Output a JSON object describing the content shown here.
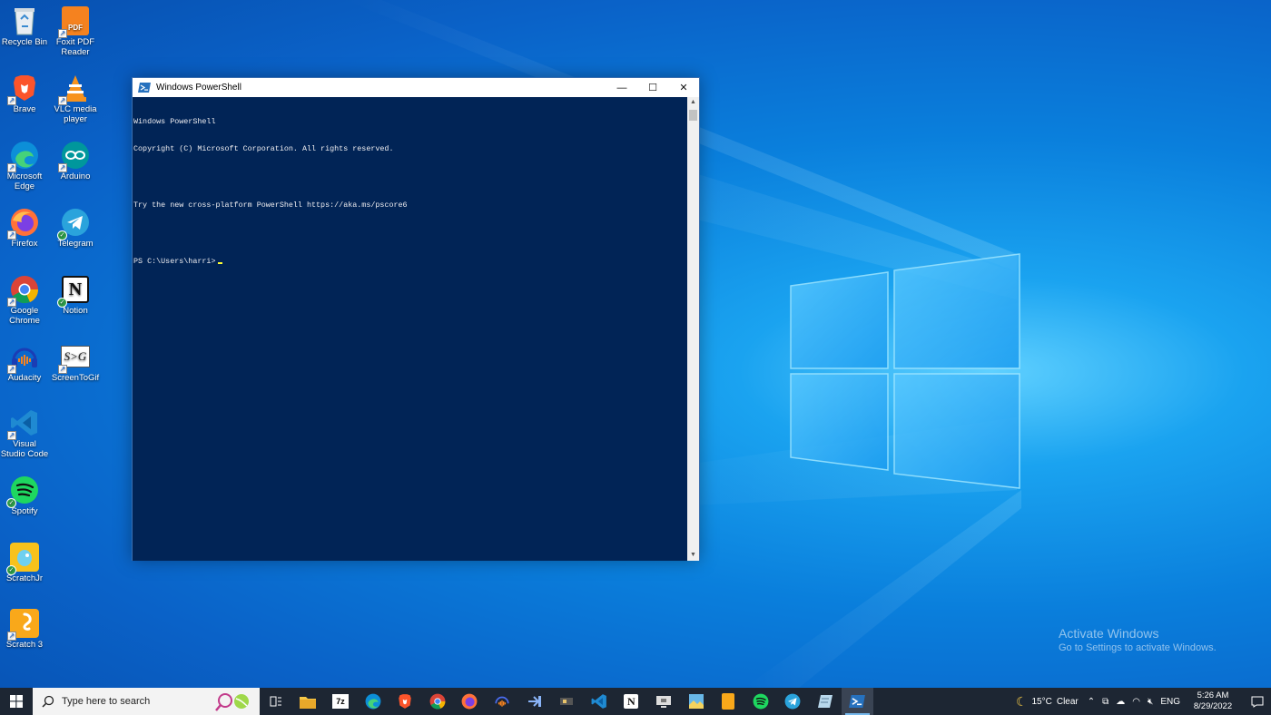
{
  "desktop_icons": [
    {
      "label": "Recycle Bin",
      "icon": "recycle-bin-icon"
    },
    {
      "label": "Foxit PDF Reader",
      "icon": "foxit-pdf-icon"
    },
    {
      "label": "Brave",
      "icon": "brave-icon"
    },
    {
      "label": "VLC media player",
      "icon": "vlc-icon"
    },
    {
      "label": "Microsoft Edge",
      "icon": "edge-icon"
    },
    {
      "label": "Arduino",
      "icon": "arduino-icon"
    },
    {
      "label": "Firefox",
      "icon": "firefox-icon"
    },
    {
      "label": "Telegram",
      "icon": "telegram-icon"
    },
    {
      "label": "Google Chrome",
      "icon": "chrome-icon"
    },
    {
      "label": "Notion",
      "icon": "notion-icon"
    },
    {
      "label": "Audacity",
      "icon": "audacity-icon"
    },
    {
      "label": "ScreenToGif",
      "icon": "screentogif-icon"
    },
    {
      "label": "Visual Studio Code",
      "icon": "vscode-icon"
    },
    {
      "label": "Spotify",
      "icon": "spotify-icon"
    },
    {
      "label": "ScratchJr",
      "icon": "scratchjr-icon"
    },
    {
      "label": "Scratch 3",
      "icon": "scratch3-icon"
    }
  ],
  "window": {
    "title": "Windows PowerShell",
    "minimize": "—",
    "maximize": "☐",
    "close": "✕"
  },
  "console": {
    "lines": [
      "Windows PowerShell",
      "Copyright (C) Microsoft Corporation. All rights reserved.",
      "",
      "Try the new cross-platform PowerShell https://aka.ms/pscore6",
      ""
    ],
    "prompt": "PS C:\\Users\\harri>"
  },
  "watermark": {
    "title": "Activate Windows",
    "subtitle": "Go to Settings to activate Windows."
  },
  "taskbar": {
    "search_placeholder": "Type here to search",
    "apps": [
      "task-view-icon",
      "file-explorer-icon",
      "7zip-icon",
      "edge-icon",
      "brave-icon",
      "chrome-icon",
      "firefox-icon",
      "audacity-icon",
      "app-icon",
      "app-icon-2",
      "vscode-icon",
      "notion-icon",
      "screen-icon",
      "paint-icon",
      "scratch-icon",
      "spotify-icon",
      "telegram-icon",
      "app-icon-3",
      "powershell-icon"
    ],
    "weather": {
      "temp": "15°C",
      "condition": "Clear"
    },
    "language": "ENG",
    "time": "5:26 AM",
    "date": "8/29/2022"
  },
  "colors": {
    "console_bg": "#012456",
    "accent": "#76b9ed"
  }
}
